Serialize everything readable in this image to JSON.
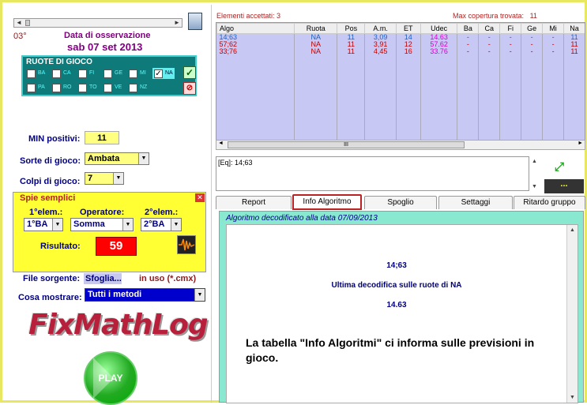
{
  "left": {
    "degree": "03°",
    "obs_label": "Data di osservazione",
    "obs_date": "sab 07 set 2013",
    "ruote_title": "RUOTE DI GIOCO",
    "ruote_row1": [
      "BA",
      "CA",
      "FI",
      "GE",
      "MI",
      "NA"
    ],
    "ruote_row2": [
      "PA",
      "RO",
      "TO",
      "VE",
      "NZ"
    ],
    "checked": "NA",
    "ok_symbol": "✓",
    "no_symbol": "⊘",
    "min_label": "MIN positivi:",
    "min_value": "11",
    "sorte_label": "Sorte di gioco:",
    "sorte_value": "Ambata",
    "colpi_label": "Colpi di gioco:",
    "colpi_value": "7",
    "spie_title": "Spie semplici",
    "close_symbol": "✕",
    "elem1_label": "1°elem.:",
    "elem1_value": "1°BA",
    "op_label": "Operatore:",
    "op_value": "Somma",
    "elem2_label": "2°elem.:",
    "elem2_value": "2°BA",
    "ris_label": "Risultato:",
    "ris_value": "59",
    "file_label": "File sorgente:",
    "file_button": "Sfoglia...",
    "file_status": "in uso (*.cmx)",
    "show_label": "Cosa mostrare:",
    "show_value": "Tutti i metodi",
    "logo_text": "FixMathLog",
    "play_label": "PLAY",
    "arrow_left": "◄",
    "arrow_right": "►",
    "dropdown_arrow": "▼"
  },
  "right": {
    "elementi": "Elementi accettati: 3",
    "max_label": "Max copertura trovata:",
    "max_value": "11",
    "columns": [
      "Algo",
      "Ruota",
      "Pos",
      "A.m.",
      "ET",
      "Udec",
      "Ba",
      "Ca",
      "Fi",
      "Ge",
      "Mi",
      "Na"
    ],
    "rows": [
      {
        "cells": [
          "14;63",
          "NA",
          "11",
          "3,09",
          "14",
          "14.63",
          "-",
          "-",
          "-",
          "-",
          "-",
          "11"
        ],
        "color": "#2060c0",
        "udec_color": "#d000d0"
      },
      {
        "cells": [
          "57;62",
          "NA",
          "11",
          "3,91",
          "12",
          "57.62",
          "-",
          "-",
          "-",
          "-",
          "-",
          "11"
        ],
        "color": "#c00000",
        "udec_color": "#d000d0"
      },
      {
        "cells": [
          "33;76",
          "NA",
          "11",
          "4,45",
          "16",
          "33.76",
          "-",
          "-",
          "-",
          "-",
          "-",
          "11"
        ],
        "color": "#c00000",
        "udec_color": "#d000d0"
      }
    ],
    "scroll_mark": "III",
    "eq_text": "[Eq]: 14;63",
    "expand_symbol": "⤢",
    "dots": "...",
    "tabs": [
      "Report",
      "Info Algoritmo",
      "Spoglio",
      "Settaggi",
      "Ritardo gruppo"
    ],
    "active_tab": "Info Algoritmo",
    "panel_head": "Algoritmo decodificato alla data 07/09/2013",
    "line1": "14;63",
    "line2": "Ultima decodifica sulle ruote di NA",
    "line3": "14.63",
    "note": "La tabella \"Info Algoritmi\" ci informa sulle previsioni in gioco.",
    "scroll_up": "▲",
    "scroll_down": "▼"
  }
}
